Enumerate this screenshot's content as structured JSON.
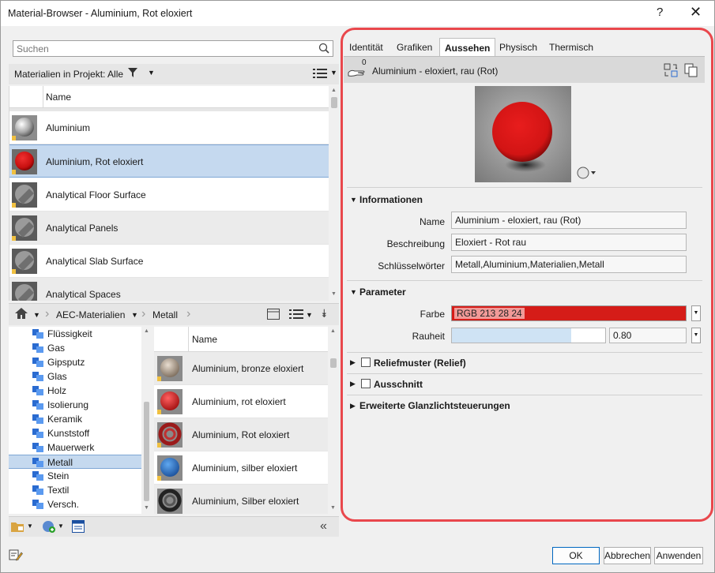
{
  "window": {
    "title": "Material-Browser - Aluminium, Rot eloxiert",
    "help": "?",
    "close": "✕"
  },
  "left": {
    "search_placeholder": "Suchen",
    "filter_label": "Materialien in Projekt: Alle",
    "list_header": "Name",
    "materials": [
      {
        "name": "Aluminium",
        "thumb": "silver-sphere"
      },
      {
        "name": "Aluminium, Rot eloxiert",
        "thumb": "red-sphere",
        "selected": true
      },
      {
        "name": "Analytical Floor Surface",
        "thumb": "analytical"
      },
      {
        "name": "Analytical Panels",
        "thumb": "analytical"
      },
      {
        "name": "Analytical Slab Surface",
        "thumb": "analytical"
      },
      {
        "name": "Analytical Spaces",
        "thumb": "analytical"
      }
    ],
    "breadcrumb": {
      "library": "AEC-Materialien",
      "category": "Metall"
    },
    "categories": [
      "Flüssigkeit",
      "Gas",
      "Gipsputz",
      "Glas",
      "Holz",
      "Isolierung",
      "Keramik",
      "Kunststoff",
      "Mauerwerk",
      "Metall",
      "Stein",
      "Textil",
      "Versch."
    ],
    "selected_category": "Metall",
    "library_header": "Name",
    "library_items": [
      {
        "name": "Aluminium, bronze eloxiert",
        "color": "#b8a89a"
      },
      {
        "name": "Aluminium, rot eloxiert",
        "color": "#d8302c"
      },
      {
        "name": "Aluminium, Rot eloxiert",
        "color": "#9b1a1a"
      },
      {
        "name": "Aluminium, silber eloxiert",
        "color": "#2f7fd0"
      },
      {
        "name": "Aluminium, Silber eloxiert",
        "color": "#333333"
      }
    ]
  },
  "right": {
    "tabs": [
      "Identität",
      "Grafiken",
      "Aussehen",
      "Physisch",
      "Thermisch"
    ],
    "active_tab": "Aussehen",
    "asset_count": "0",
    "asset_name": "Aluminium - eloxiert, rau (Rot)",
    "info": {
      "heading": "Informationen",
      "name_label": "Name",
      "name_value": "Aluminium - eloxiert, rau (Rot)",
      "desc_label": "Beschreibung",
      "desc_value": "Eloxiert - Rot rau",
      "keys_label": "Schlüsselwörter",
      "keys_value": "Metall,Aluminium,Materialien,Metall"
    },
    "params": {
      "heading": "Parameter",
      "color_label": "Farbe",
      "color_value": "RGB 213 28 24",
      "color_hex": "#d51c18",
      "rough_label": "Rauheit",
      "rough_value": "0.80"
    },
    "sections": [
      "Reliefmuster (Relief)",
      "Ausschnitt",
      "Erweiterte Glanzlichtsteuerungen"
    ]
  },
  "buttons": {
    "ok": "OK",
    "cancel": "Abbrechen",
    "apply": "Anwenden"
  }
}
